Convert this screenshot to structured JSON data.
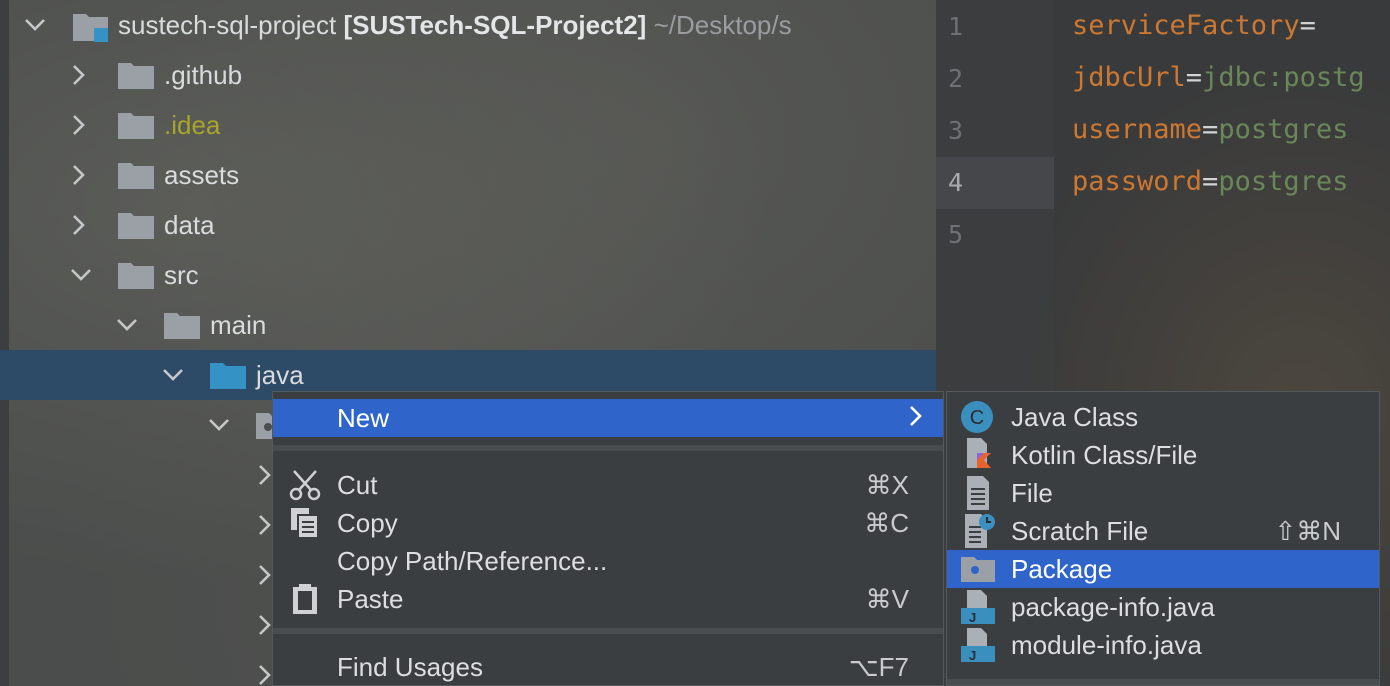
{
  "tree": {
    "project": {
      "name": "sustech-sql-project",
      "module": "[SUSTech-SQL-Project2]",
      "path": "~/Desktop/s"
    },
    "items": [
      {
        "label": ".github"
      },
      {
        "label": ".idea"
      },
      {
        "label": "assets"
      },
      {
        "label": "data"
      },
      {
        "label": "src"
      },
      {
        "label": "main"
      },
      {
        "label": "java"
      }
    ]
  },
  "editor": {
    "line_numbers": [
      "1",
      "2",
      "3",
      "4",
      "5"
    ],
    "current_line": 4,
    "lines": [
      {
        "key": "serviceFactory",
        "eq": "=",
        "value": ""
      },
      {
        "key": "jdbcUrl",
        "eq": "=",
        "value": "jdbc:postg"
      },
      {
        "key": "username",
        "eq": "=",
        "value": "postgres"
      },
      {
        "key": "password",
        "eq": "=",
        "value": "postgres"
      }
    ]
  },
  "context_menu": {
    "new": {
      "label": "New",
      "arrow": "›"
    },
    "cut": {
      "label": "Cut",
      "shortcut": "⌘X",
      "icon": "scissors-icon"
    },
    "copy": {
      "label": "Copy",
      "shortcut": "⌘C",
      "icon": "copy-icon"
    },
    "copy_path": {
      "label": "Copy Path/Reference..."
    },
    "paste": {
      "label": "Paste",
      "shortcut": "⌘V",
      "icon": "clipboard-icon"
    },
    "find_usages": {
      "label": "Find Usages",
      "shortcut": "⌥F7"
    }
  },
  "submenu": {
    "java_class": {
      "label": "Java Class",
      "icon_letter": "C"
    },
    "kotlin": {
      "label": "Kotlin Class/File"
    },
    "file": {
      "label": "File"
    },
    "scratch": {
      "label": "Scratch File",
      "shortcut": "⇧⌘N"
    },
    "package": {
      "label": "Package"
    },
    "package_info": {
      "label": "package-info.java",
      "icon_letter": "J"
    },
    "module_info": {
      "label": "module-info.java",
      "icon_letter": "J"
    }
  },
  "colors": {
    "selection": "#2f65ca",
    "tree_selection": "#2d4a66",
    "keyword": "#cc7832",
    "string_value": "#6a8759",
    "idea_folder": "#a7a52a"
  }
}
